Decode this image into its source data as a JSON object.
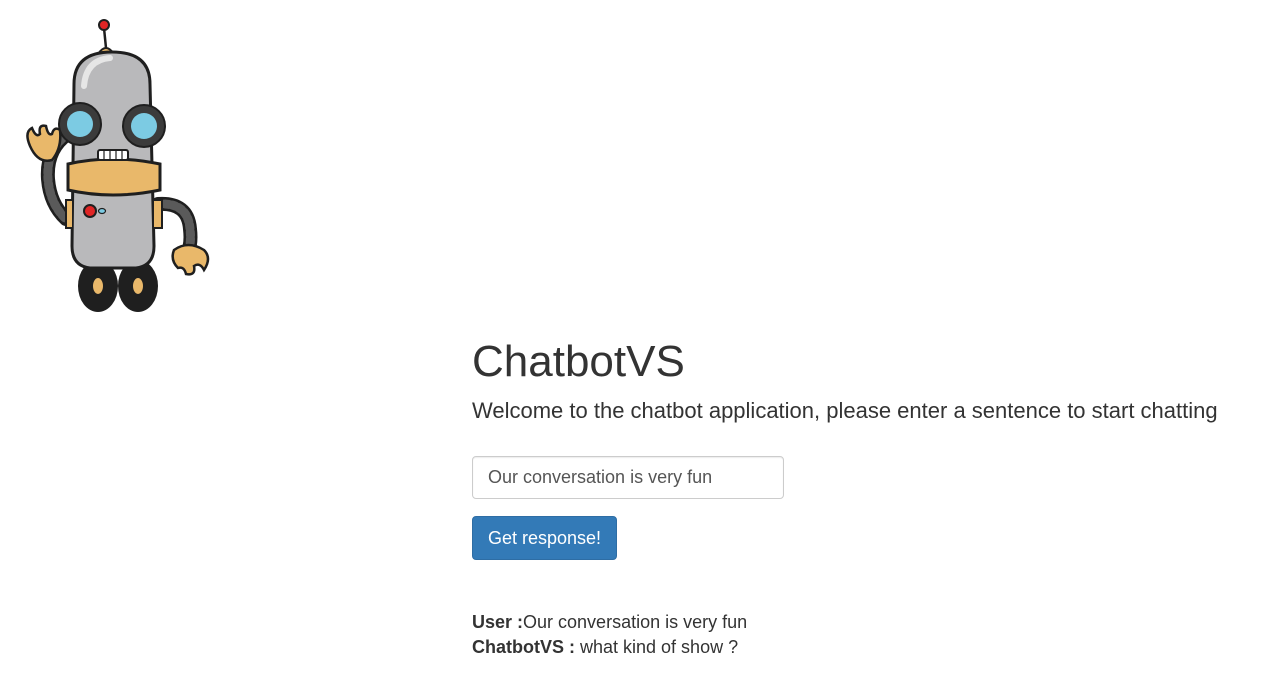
{
  "header": {
    "title": "ChatbotVS",
    "subtitle": "Welcome to the chatbot application, please enter a sentence to start chatting"
  },
  "form": {
    "input_value": "Our conversation is very fun",
    "button_label": "Get response!"
  },
  "conversation": [
    {
      "speaker": "User :",
      "text": "Our conversation is very fun"
    },
    {
      "speaker": "ChatbotVS :",
      "text": " what kind of show ?"
    }
  ],
  "logo": {
    "icon": "robot-icon",
    "colors": {
      "body": "#b9b9bb",
      "collar": "#e9b86a",
      "lens": "#7ccbe3",
      "button": "#e02525",
      "outline": "#1f1f1f"
    }
  },
  "colors": {
    "accent": "#337ab7",
    "text": "#333333"
  }
}
